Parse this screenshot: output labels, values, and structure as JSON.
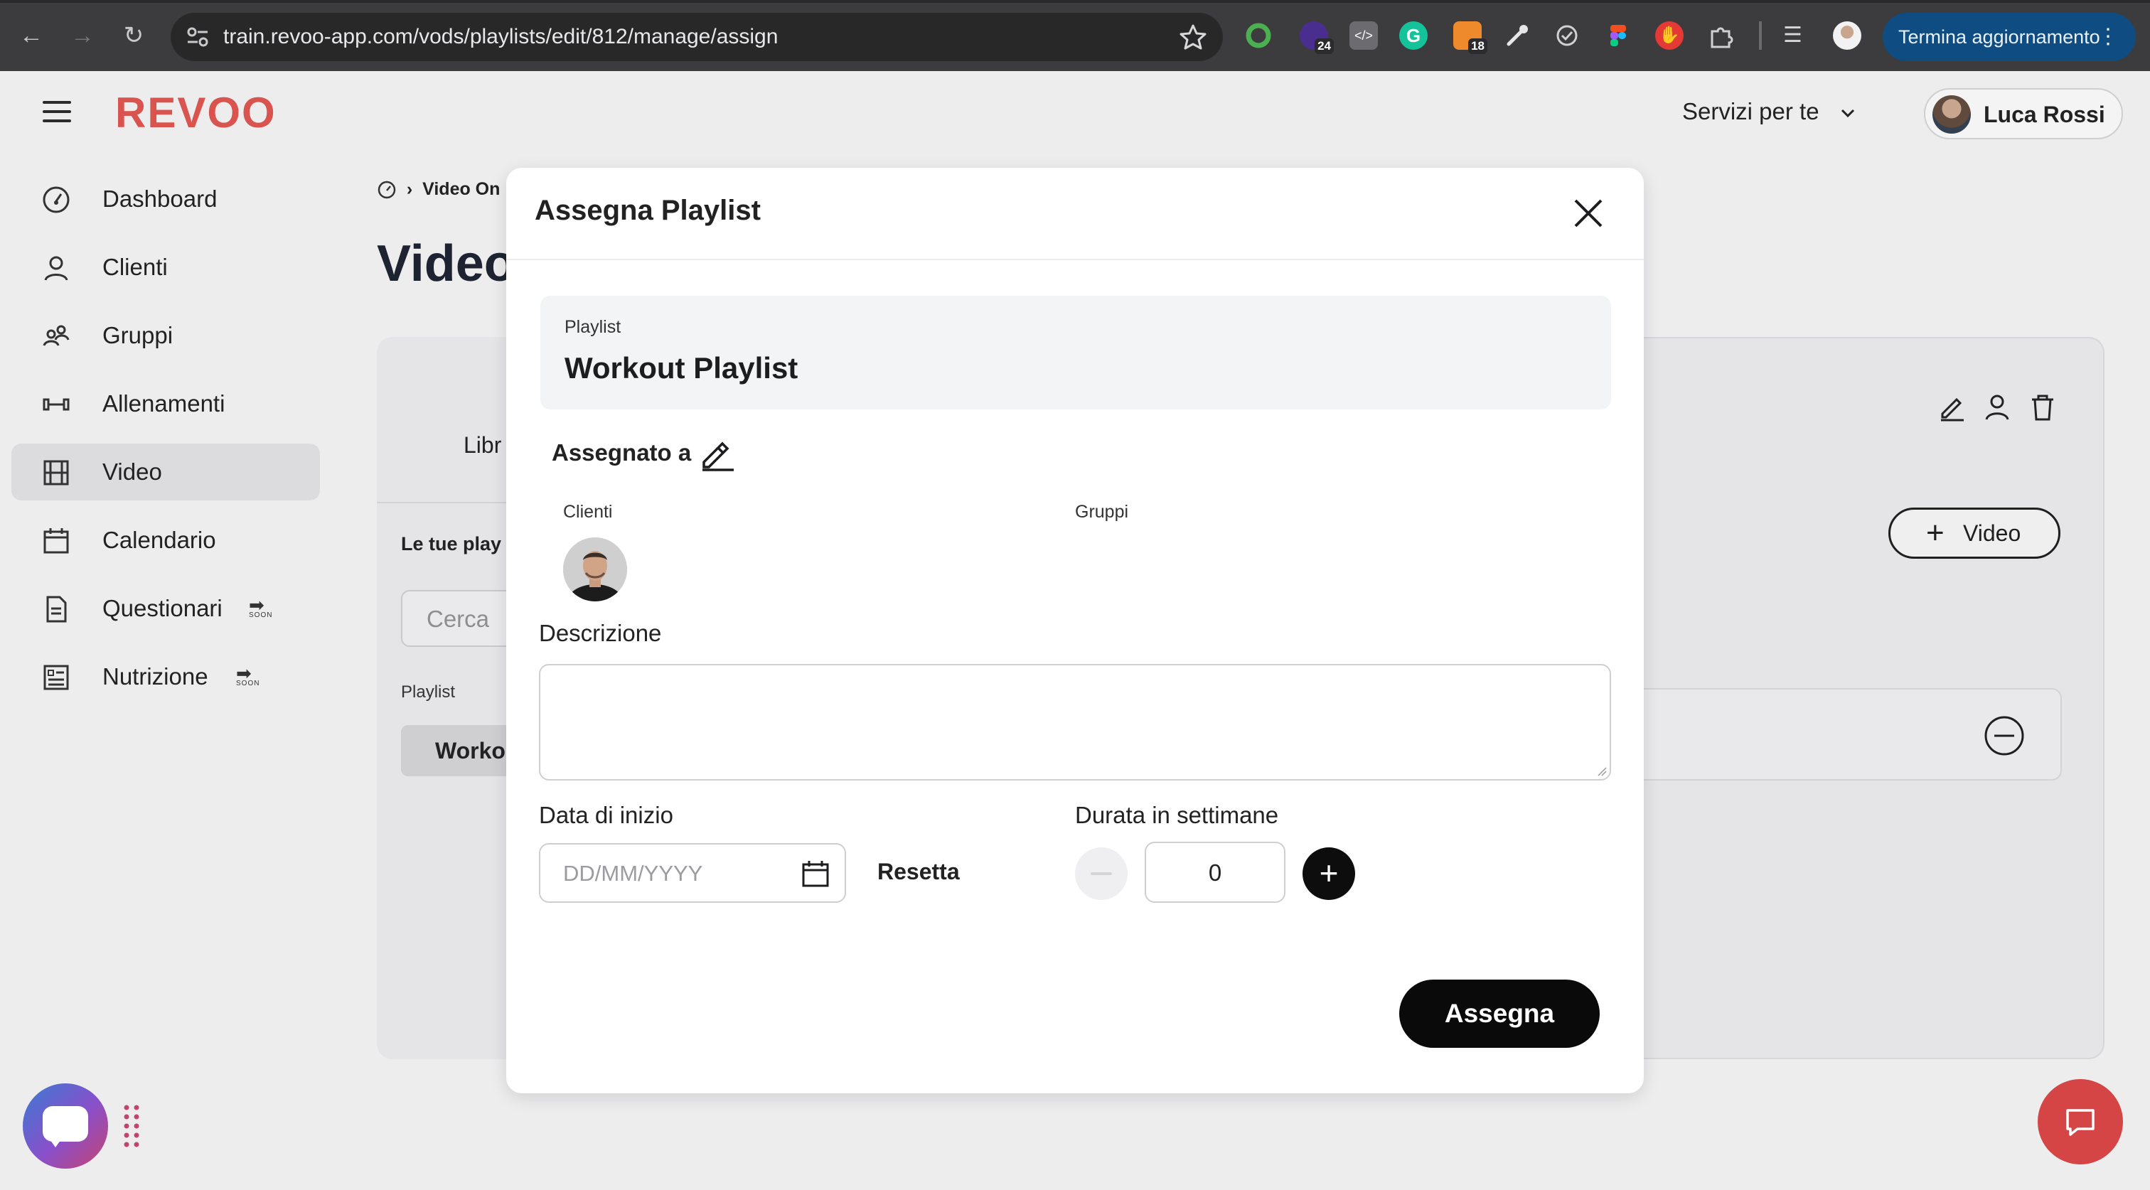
{
  "browser": {
    "url": "train.revoo-app.com/vods/playlists/edit/812/manage/assign",
    "ext_badge_1": "24",
    "ext_badge_2": "18",
    "update_label": "Termina aggiornamento"
  },
  "header": {
    "logo": "REVOO",
    "services_label": "Servizi per te",
    "user_name": "Luca Rossi"
  },
  "sidebar": {
    "items": [
      {
        "label": "Dashboard",
        "icon": "gauge-icon"
      },
      {
        "label": "Clienti",
        "icon": "user-icon"
      },
      {
        "label": "Gruppi",
        "icon": "users-icon"
      },
      {
        "label": "Allenamenti",
        "icon": "dumbbell-icon"
      },
      {
        "label": "Video",
        "icon": "film-icon",
        "active": true
      },
      {
        "label": "Calendario",
        "icon": "calendar-icon"
      },
      {
        "label": "Questionari",
        "icon": "document-icon",
        "soon": true
      },
      {
        "label": "Nutrizione",
        "icon": "list-icon",
        "soon": true
      }
    ],
    "soon_label": "SOON"
  },
  "page": {
    "breadcrumb": "Video On",
    "title": "Video",
    "tab_partial": "Libr",
    "section_partial": "Le tue play",
    "search_placeholder": "Cerca",
    "playlist_label": "Playlist",
    "playlist_row_partial": "Worko",
    "add_video_label": "Video"
  },
  "modal": {
    "title": "Assegna Playlist",
    "playlist_key": "Playlist",
    "playlist_value": "Workout Playlist",
    "assigned_label": "Assegnato a",
    "clients_label": "Clienti",
    "groups_label": "Gruppi",
    "description_label": "Descrizione",
    "description_value": "",
    "start_date_label": "Data di inizio",
    "start_date_placeholder": "DD/MM/YYYY",
    "reset_label": "Resetta",
    "duration_label": "Durata in settimane",
    "duration_value": "0",
    "assign_button": "Assegna"
  },
  "colors": {
    "brand": "#d9534f",
    "primary_button": "#0a0a0a",
    "update_button": "#0f4c81",
    "chat_button": "#d64545"
  }
}
